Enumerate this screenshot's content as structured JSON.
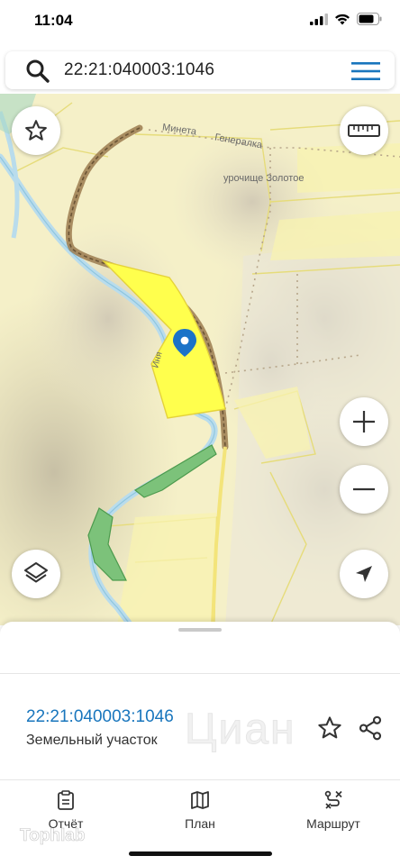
{
  "status_bar": {
    "time": "11:04"
  },
  "search": {
    "query": "22:21:040003:1046"
  },
  "map": {
    "labels": {
      "road_name_1": "Минета",
      "road_name_2": "Генералка",
      "area_name": "урочище Золотое",
      "river_name": "Иня"
    },
    "parcel_color": "#ffff4d",
    "marker_color": "#1a73c8"
  },
  "sheet": {
    "parcel_id": "22:21:040003:1046",
    "parcel_type": "Земельный участок",
    "watermark": "Циан"
  },
  "tabs": [
    {
      "label": "Отчёт",
      "icon": "report-icon"
    },
    {
      "label": "План",
      "icon": "map-book-icon"
    },
    {
      "label": "Маршрут",
      "icon": "route-icon"
    }
  ],
  "watermark_corner": "Tophlab",
  "accent_color": "#1976bd"
}
